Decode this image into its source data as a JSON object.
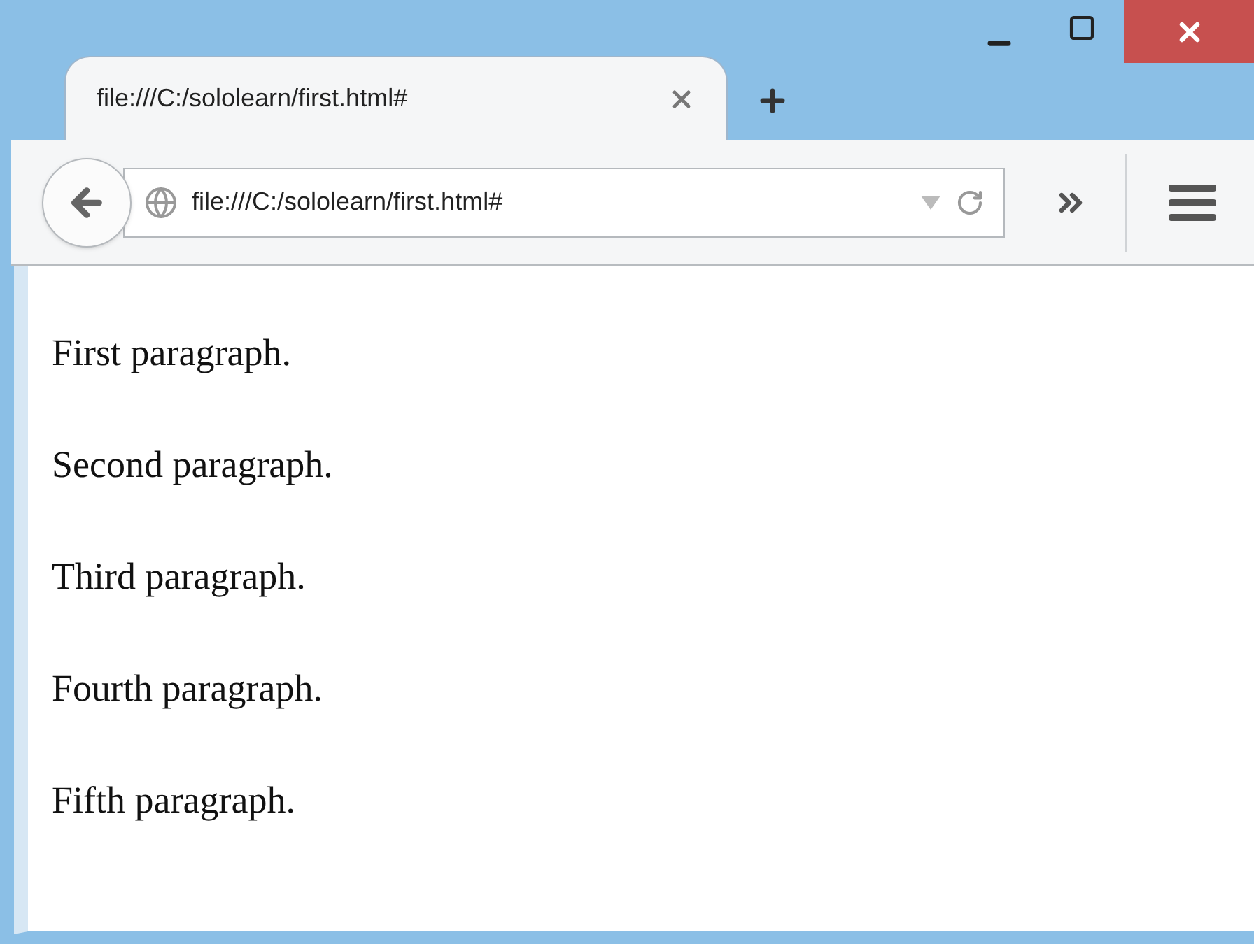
{
  "tabs": [
    {
      "title": "file:///C:/sololearn/first.html#",
      "selected": true
    }
  ],
  "address_bar": {
    "url": "file:///C:/sololearn/first.html#"
  },
  "paragraphs": [
    "First paragraph.",
    "Second paragraph.",
    "Third paragraph.",
    "Fourth paragraph.",
    "Fifth paragraph."
  ]
}
